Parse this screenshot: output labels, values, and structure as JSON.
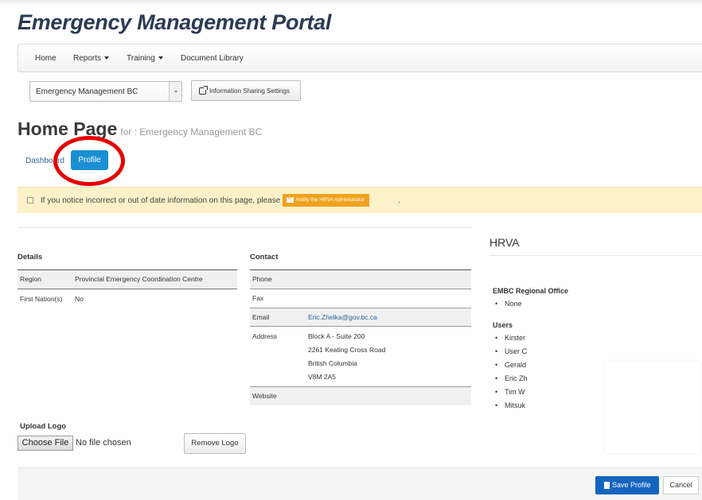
{
  "app": {
    "title": "Emergency Management Portal"
  },
  "nav": {
    "home": "Home",
    "reports": "Reports",
    "training": "Training",
    "document_library": "Document Library"
  },
  "org_select": {
    "value": "Emergency Management BC"
  },
  "info_sharing_button": "Information Sharing Settings",
  "page": {
    "title": "Home Page",
    "subtitle": "for : Emergency Management BC"
  },
  "tabs": {
    "dashboard": "Dashboard",
    "profile": "Profile"
  },
  "alert": {
    "text": "If you notice incorrect or out of date information on this page, please",
    "button": "Notify the HRVA Administrator",
    "suffix": "."
  },
  "details": {
    "heading": "Details",
    "rows": [
      {
        "label": "Region",
        "value": "Provincial Emergency Coordination Centre"
      },
      {
        "label": "First Nation(s)",
        "value": "No"
      }
    ]
  },
  "contact": {
    "heading": "Contact",
    "phone_label": "Phone",
    "fax_label": "Fax",
    "email_label": "Email",
    "email_value": "Eric.Zhelka@gov.bc.ca",
    "address_label": "Address",
    "address_lines": [
      "Block A - Suite 200",
      "2261 Keating Cross Road",
      "British Columbia",
      "V8M 2A5"
    ],
    "website_label": "Website"
  },
  "hrva": {
    "title": "HRVA",
    "office_heading": "EMBC Regional Office",
    "office_items": [
      "None"
    ],
    "users_heading": "Users",
    "users": [
      "Kirster",
      "User C",
      "Gerald",
      "Eric Zh",
      "Tim W",
      "Mitsuk"
    ]
  },
  "upload": {
    "label": "Upload Logo",
    "choose_button": "Choose File",
    "no_file": "No file chosen",
    "remove_button": "Remove Logo"
  },
  "footer": {
    "save": "Save Profile",
    "cancel": "Cancel"
  },
  "colors": {
    "accent": "#1a8fd4",
    "annotation_circle": "#e50000",
    "alert_bg": "#fcf1c9",
    "notify_btn": "#f0a21e",
    "save_btn": "#1565c0"
  }
}
